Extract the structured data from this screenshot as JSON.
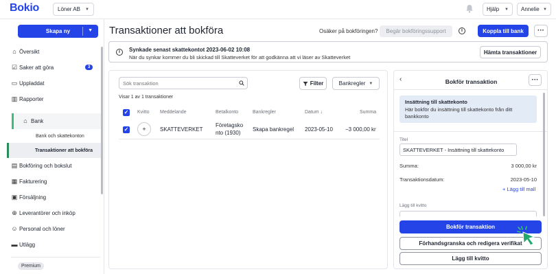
{
  "topbar": {
    "logo": "Bokio",
    "company": "Löner AB",
    "help": "Hjälp",
    "user": "Annelie"
  },
  "sidebar": {
    "create_label": "Skapa ny",
    "items": [
      {
        "label": "Översikt",
        "icon": "home-icon"
      },
      {
        "label": "Saker att göra",
        "icon": "checklist-icon",
        "badge": "3"
      },
      {
        "label": "Uppladdat",
        "icon": "folder-icon"
      },
      {
        "label": "Rapporter",
        "icon": "bar-chart-icon"
      },
      {
        "label": "Bank",
        "icon": "bank-icon"
      },
      {
        "label": "Bokföring och bokslut",
        "icon": "book-icon"
      },
      {
        "label": "Fakturering",
        "icon": "invoice-icon"
      },
      {
        "label": "Försäljning",
        "icon": "sales-icon"
      },
      {
        "label": "Leverantörer och inköp",
        "icon": "supplier-icon"
      },
      {
        "label": "Personal och löner",
        "icon": "person-icon"
      },
      {
        "label": "Utlägg",
        "icon": "expense-icon"
      }
    ],
    "sub_items": [
      {
        "label": "Bank och skattekonton"
      },
      {
        "label": "Transaktioner att bokföra"
      }
    ],
    "plan_badge": "Premium"
  },
  "header": {
    "title": "Transaktioner att bokföra",
    "unsure_text": "Osäker på bokföringen?",
    "support_button": "Begär bokföringssupport",
    "connect_button": "Koppla till bank"
  },
  "banner": {
    "title": "Synkade senast skattekontot 2023-06-02 10:08",
    "text": "När du synkar kommer du bli skickad till Skatteverket för att godkänna att vi läser av Skatteverket",
    "button": "Hämta transaktioner"
  },
  "list": {
    "search_placeholder": "Sök transaktion",
    "filter_button": "Filter",
    "rules_button": "Bankregler",
    "showing_text": "Visar 1 av 1 transaktioner",
    "columns": {
      "receipt": "Kvitto",
      "message": "Meddelande",
      "account": "Betalkonto",
      "rules": "Bankregler",
      "date": "Datum ↓",
      "amount": "Summa"
    },
    "rows": [
      {
        "message": "SKATTEVERKET",
        "account_line1": "Företagsko",
        "account_line2": "nto (1930)",
        "rule": "Skapa bankregel",
        "date": "2023-05-10",
        "amount": "−3 000,00 kr"
      }
    ]
  },
  "panel": {
    "title": "Bokför transaktion",
    "info_title": "Insättning till skattekonto",
    "info_text": "Här bokför du insättning till skattekonto från ditt bankkonto",
    "title_label": "Titel",
    "title_value": "SKATTEVERKET - Insättning till skattekonto",
    "sum_label": "Summa:",
    "sum_value": "3 000,00 kr",
    "date_label": "Transaktionsdatum:",
    "date_value": "2023-05-10",
    "add_rule": "+ Lägg till mall",
    "receipt_label": "Lägg till kvitto",
    "book_button": "Bokför transaktion",
    "preview_button": "Förhandsgranska och redigera verifikat",
    "receipt_button": "Lägg till kvitto"
  },
  "colors": {
    "accent": "#2444e8",
    "active_green": "#3dbc7d",
    "info_bg": "#e3ebf7"
  }
}
